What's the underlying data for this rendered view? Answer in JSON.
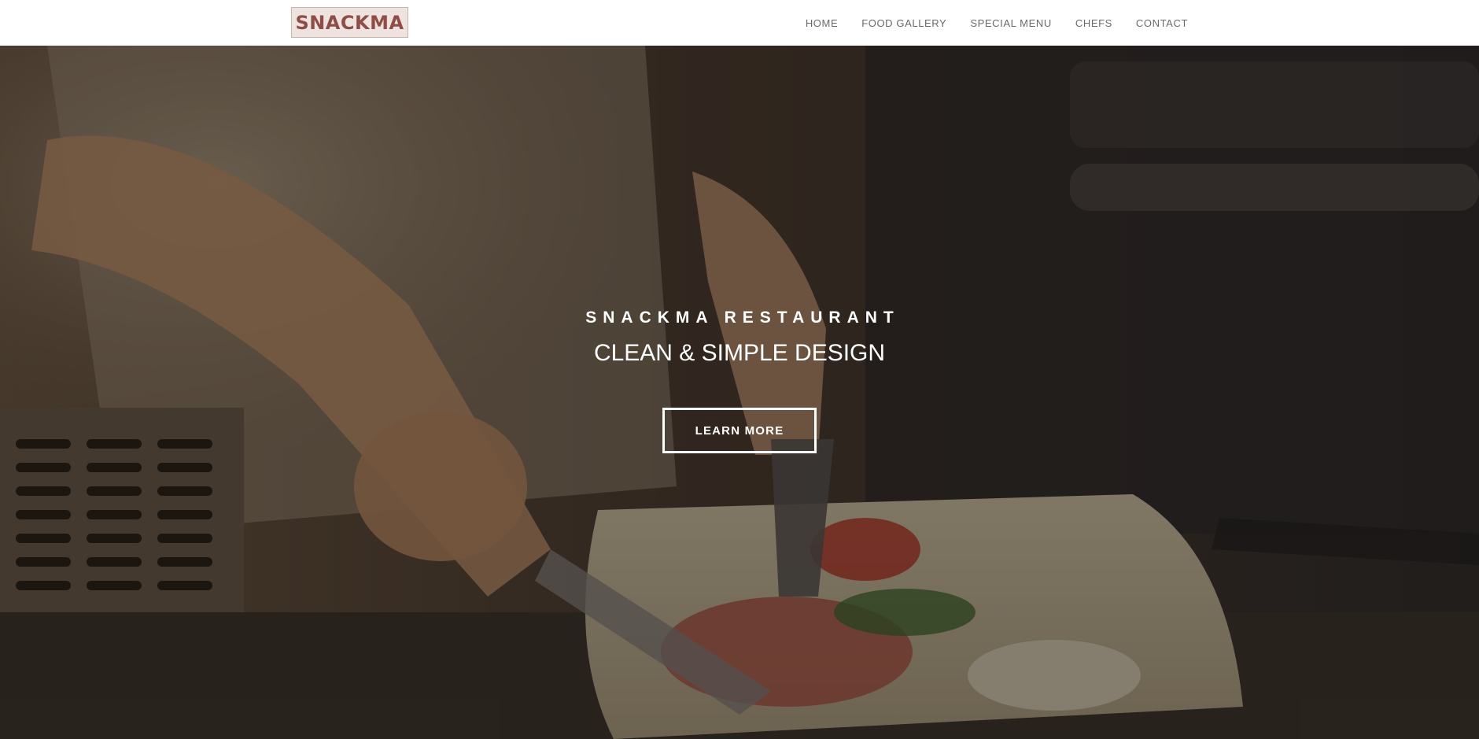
{
  "brand": {
    "logo_text": "SNACKMA",
    "logo_color": "#8f4d47",
    "logo_bg": "#efe3e0"
  },
  "nav": {
    "items": [
      {
        "label": "HOME"
      },
      {
        "label": "FOOD GALLERY"
      },
      {
        "label": "SPECIAL MENU"
      },
      {
        "label": "CHEFS"
      },
      {
        "label": "CONTACT"
      }
    ]
  },
  "hero": {
    "subtitle": "SNACKMA RESTAURANT",
    "title": "CLEAN & SIMPLE DESIGN",
    "button_label": "LEARN MORE",
    "image_subject": "chef plating shrimp dish"
  }
}
